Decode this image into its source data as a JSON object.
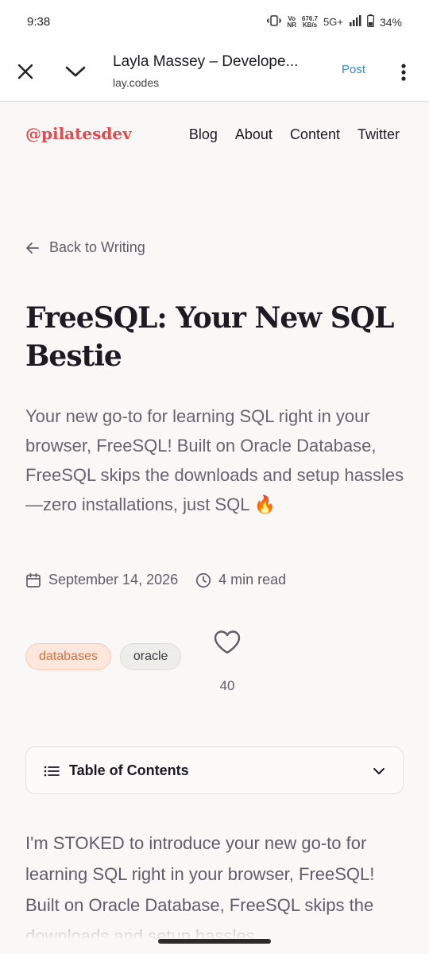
{
  "status_bar": {
    "time": "9:38",
    "volte_top": "Vo",
    "volte_bottom": "NR",
    "speed_top": "676.7",
    "speed_bottom": "KB/s",
    "network": "5G+",
    "battery": "34%",
    "icons": [
      "vibrate-icon",
      "signal-icon",
      "battery-icon"
    ]
  },
  "browser": {
    "page_title": "Layla Massey – Develope...",
    "url": "lay.codes",
    "post_action": "Post",
    "accent": "#2e8ad8"
  },
  "site": {
    "logo": "@pilatesdev",
    "logo_color": "#e5484d",
    "nav": [
      "Blog",
      "About",
      "Content",
      "Twitter"
    ]
  },
  "article": {
    "back_label": "Back to Writing",
    "title": "FreeSQL: Your New SQL Bestie",
    "summary": "Your new go-to for learning SQL right in your browser, FreeSQL! Built on Oracle Database, FreeSQL skips the downloads and setup hassles—zero installations, just SQL 🔥",
    "date": "September 14, 2026",
    "read_time": "4 min read",
    "tags": [
      "databases",
      "oracle"
    ],
    "likes": "40",
    "toc_label": "Table of Contents",
    "body_first": "I'm STOKED to introduce your new go-to for learning SQL right in your browser, FreeSQL! Built on Oracle Database, FreeSQL skips the downloads and setup hassles"
  }
}
